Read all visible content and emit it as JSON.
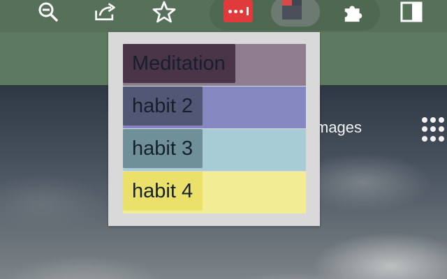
{
  "toolbar": {
    "icons": [
      "zoom-out-icon",
      "share-icon",
      "star-icon",
      "password-manager-icon",
      "habit-tracker-icon",
      "extensions-puzzle-icon",
      "sidebar-icon"
    ]
  },
  "page": {
    "images_link": "mages"
  },
  "popup": {
    "habits": [
      {
        "label": "Meditation",
        "row_color": "#8e7d8f",
        "label_color": "#4a3448"
      },
      {
        "label": "habit 2",
        "row_color": "#8587c0",
        "label_color": "#525775"
      },
      {
        "label": "habit 3",
        "row_color": "#a8ccd5",
        "label_color": "#6f9099"
      },
      {
        "label": "habit 4",
        "row_color": "#f2ed94",
        "label_color": "#ebe06a"
      }
    ]
  },
  "colors": {
    "toolbar_bg": "#56705a",
    "popup_bg": "#d9d9d9",
    "extension_red": "#e03a3a"
  }
}
